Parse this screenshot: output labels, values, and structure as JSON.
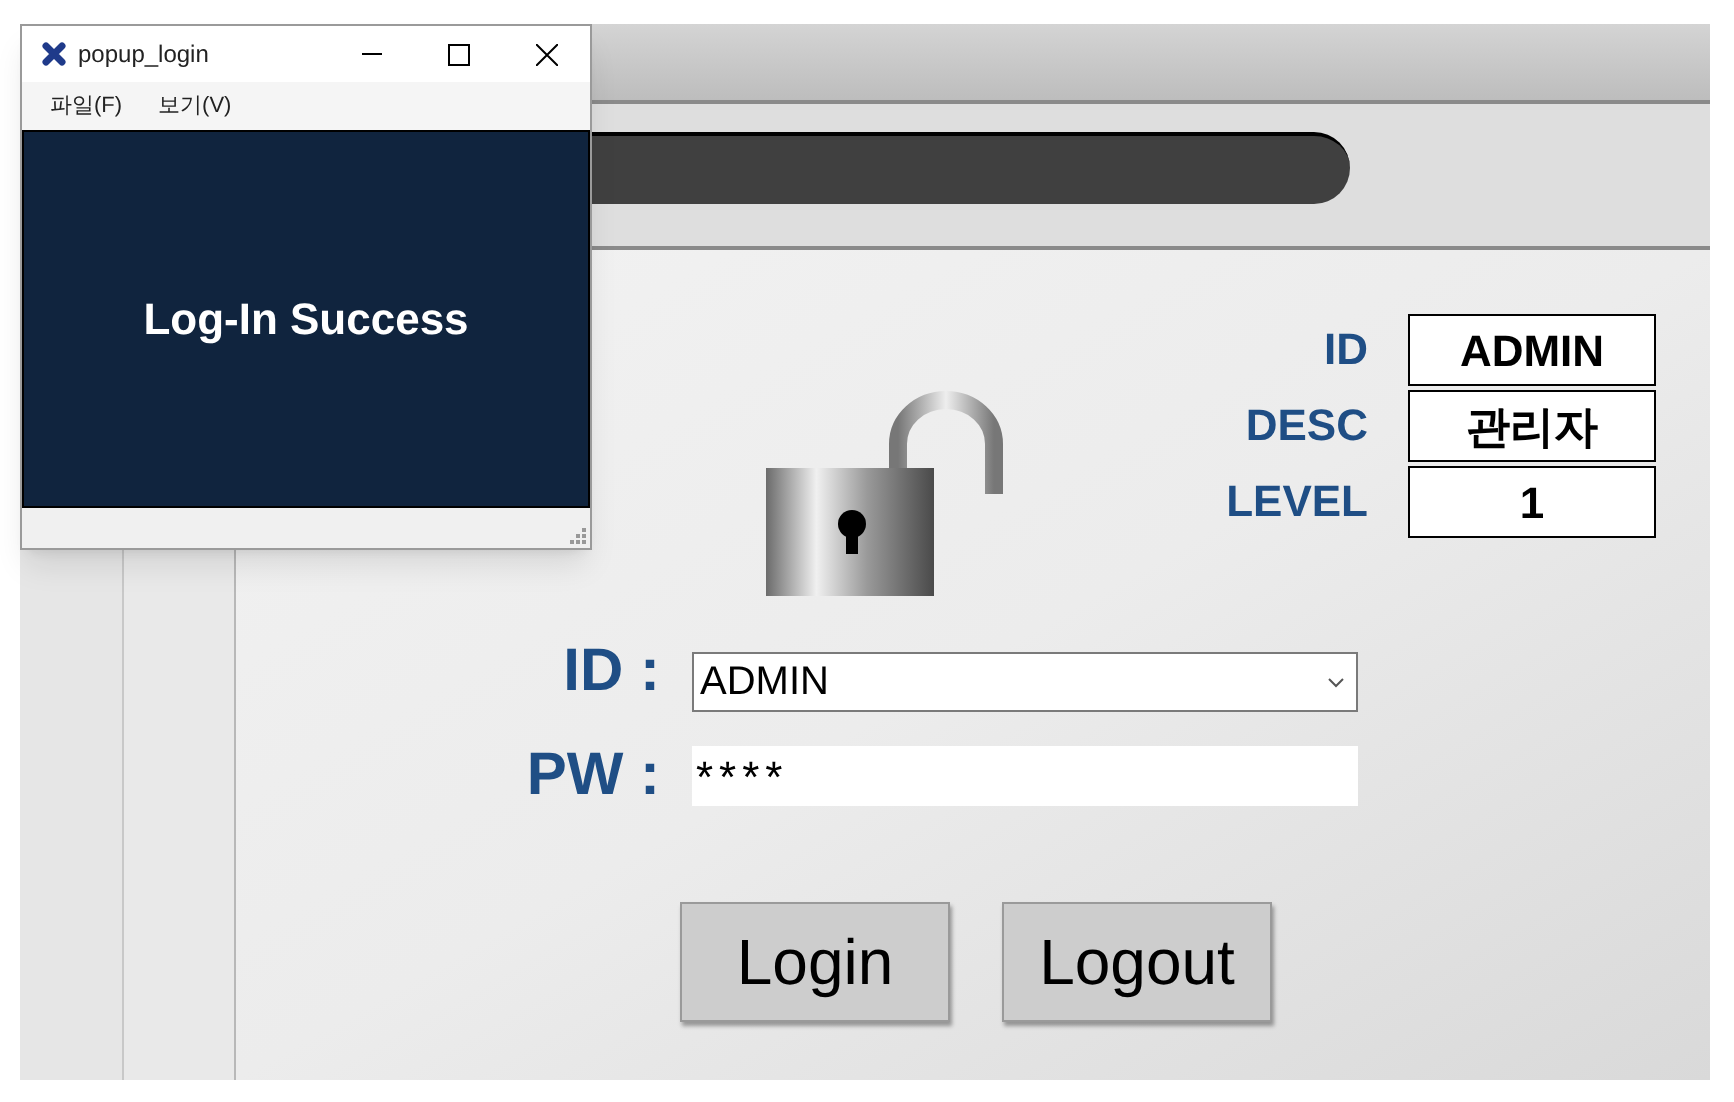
{
  "main_window": {
    "info": [
      {
        "label": "ID",
        "value": "ADMIN"
      },
      {
        "label": "DESC",
        "value": "관리자"
      },
      {
        "label": "LEVEL",
        "value": "1"
      }
    ],
    "login_form": {
      "id_label": "ID :",
      "id_value": "ADMIN",
      "pw_label": "PW :",
      "pw_value": "****"
    },
    "buttons": [
      "Login",
      "Logout"
    ]
  },
  "popup": {
    "title": "popup_login",
    "menu": [
      "파일(F)",
      "보기(V)"
    ],
    "message": "Log-In Success"
  }
}
